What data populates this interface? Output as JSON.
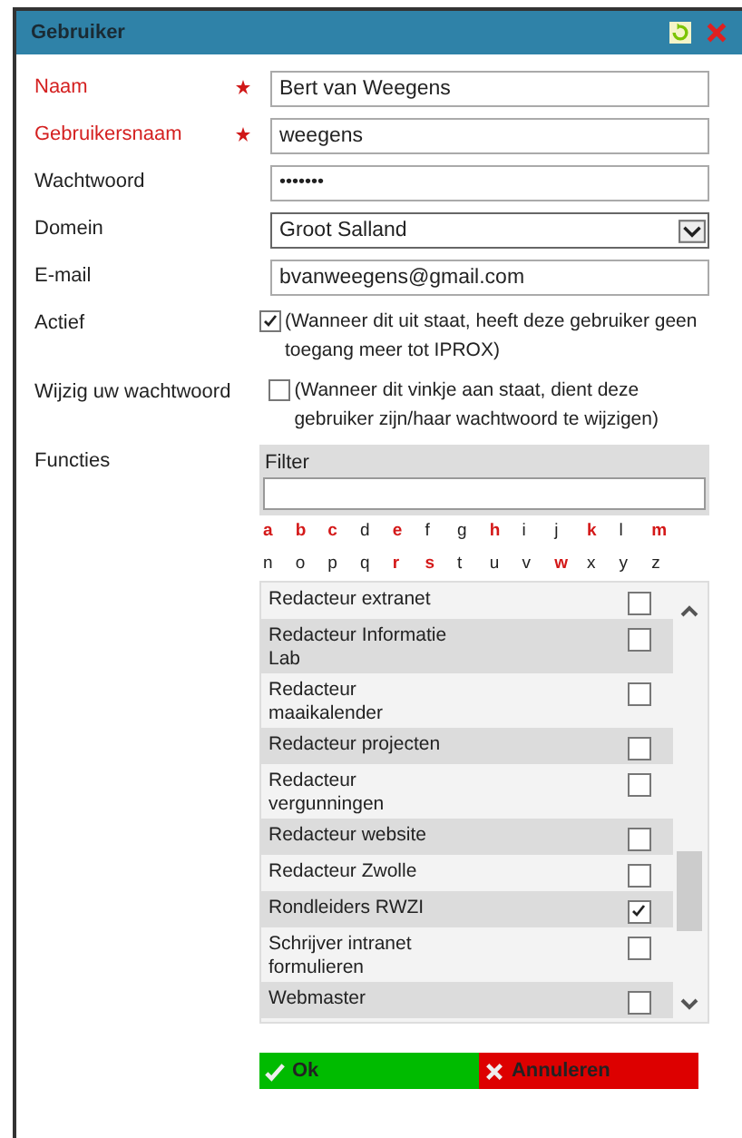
{
  "window": {
    "title": "Gebruiker"
  },
  "fields": [
    {
      "label": "Naam",
      "required": true,
      "kind": "text",
      "value": "Bert van Weegens"
    },
    {
      "label": "Gebruikersnaam",
      "required": true,
      "kind": "text",
      "value": "weegens"
    },
    {
      "label": "Wachtwoord",
      "required": false,
      "kind": "password",
      "value": "•••••••"
    },
    {
      "label": "Domein",
      "required": false,
      "kind": "select",
      "value": "Groot Salland"
    },
    {
      "label": "E-mail",
      "required": false,
      "kind": "text",
      "value": "bvanweegens@gmail.com"
    }
  ],
  "checks": [
    {
      "label": "Actief",
      "checked": true,
      "note": "(Wanneer dit uit staat, heeft deze gebruiker geen toegang meer tot IPROX)"
    },
    {
      "label": "Wijzig uw wachtwoord",
      "checked": false,
      "note": "(Wanneer dit vinkje aan staat, dient deze gebruiker zijn/haar wachtwoord te wijzigen)"
    }
  ],
  "functies": {
    "label": "Functies",
    "filter_label": "Filter",
    "letters": [
      {
        "letter": "a",
        "active": true
      },
      {
        "letter": "b",
        "active": true
      },
      {
        "letter": "c",
        "active": true
      },
      {
        "letter": "d",
        "active": false
      },
      {
        "letter": "e",
        "active": true
      },
      {
        "letter": "f",
        "active": false
      },
      {
        "letter": "g",
        "active": false
      },
      {
        "letter": "h",
        "active": true
      },
      {
        "letter": "i",
        "active": false
      },
      {
        "letter": "j",
        "active": false
      },
      {
        "letter": "k",
        "active": true
      },
      {
        "letter": "l",
        "active": false
      },
      {
        "letter": "m",
        "active": true
      },
      {
        "letter": "n",
        "active": false
      },
      {
        "letter": "o",
        "active": false
      },
      {
        "letter": "p",
        "active": false
      },
      {
        "letter": "q",
        "active": false
      },
      {
        "letter": "r",
        "active": true
      },
      {
        "letter": "s",
        "active": true
      },
      {
        "letter": "t",
        "active": false
      },
      {
        "letter": "u",
        "active": false
      },
      {
        "letter": "v",
        "active": false
      },
      {
        "letter": "w",
        "active": true
      },
      {
        "letter": "x",
        "active": false
      },
      {
        "letter": "y",
        "active": false
      },
      {
        "letter": "z",
        "active": false
      }
    ],
    "items": [
      {
        "name": "Redacteur extranet",
        "checked": false
      },
      {
        "name": "Redacteur Informatie Lab",
        "checked": false
      },
      {
        "name": "Redacteur maaikalender",
        "checked": false
      },
      {
        "name": "Redacteur projecten",
        "checked": false
      },
      {
        "name": "Redacteur vergunningen",
        "checked": false
      },
      {
        "name": "Redacteur website",
        "checked": false
      },
      {
        "name": "Redacteur Zwolle",
        "checked": false
      },
      {
        "name": "Rondleiders RWZI",
        "checked": true
      },
      {
        "name": "Schrijver intranet formulieren",
        "checked": false
      },
      {
        "name": "Webmaster",
        "checked": false
      }
    ]
  },
  "buttons": [
    {
      "kind": "ok",
      "label": "Ok"
    },
    {
      "kind": "cancel",
      "label": "Annuleren"
    }
  ]
}
